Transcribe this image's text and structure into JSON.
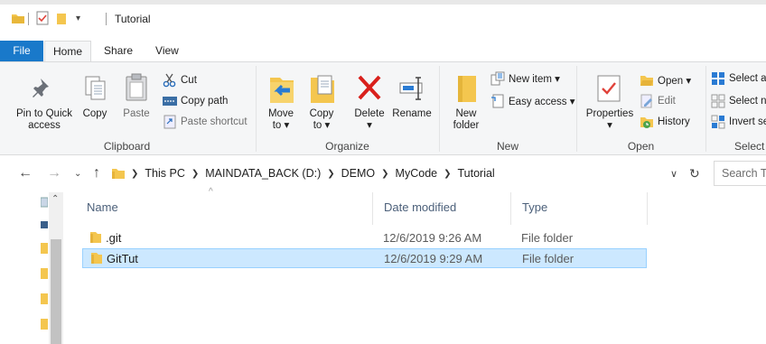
{
  "window": {
    "title": "Tutorial"
  },
  "ribbon_tabs": [
    "File",
    "Home",
    "Share",
    "View"
  ],
  "clipboard": {
    "pin_label_1": "Pin to Quick",
    "pin_label_2": "access",
    "copy": "Copy",
    "paste": "Paste",
    "cut": "Cut",
    "copy_path": "Copy path",
    "paste_shortcut": "Paste shortcut",
    "group": "Clipboard"
  },
  "organize": {
    "move_to_1": "Move",
    "move_to_2": "to ▾",
    "copy_to_1": "Copy",
    "copy_to_2": "to ▾",
    "delete": "Delete",
    "delete_arrow": "▾",
    "rename": "Rename",
    "group": "Organize"
  },
  "new": {
    "new_folder_1": "New",
    "new_folder_2": "folder",
    "new_item": "New item ▾",
    "easy_access": "Easy access ▾",
    "group": "New"
  },
  "open": {
    "properties": "Properties",
    "properties_arrow": "▾",
    "open": "Open ▾",
    "edit": "Edit",
    "history": "History",
    "group": "Open"
  },
  "select": {
    "select_all": "Select all",
    "select_none": "Select none",
    "invert": "Invert selection",
    "group": "Select"
  },
  "address": {
    "crumbs": [
      "This PC",
      "MAINDATA_BACK (D:)",
      "DEMO",
      "MyCode",
      "Tutorial"
    ],
    "search_placeholder": "Search Tutorial"
  },
  "columns": {
    "name": "Name",
    "date": "Date modified",
    "type": "Type"
  },
  "files": [
    {
      "name": ".git",
      "date": "12/6/2019 9:26 AM",
      "type": "File folder",
      "selected": false
    },
    {
      "name": "GitTut",
      "date": "12/6/2019 9:29 AM",
      "type": "File folder",
      "selected": true
    }
  ],
  "colors": {
    "accent": "#1979ca",
    "selection": "#cce8ff",
    "folder": "#f4c64f"
  }
}
